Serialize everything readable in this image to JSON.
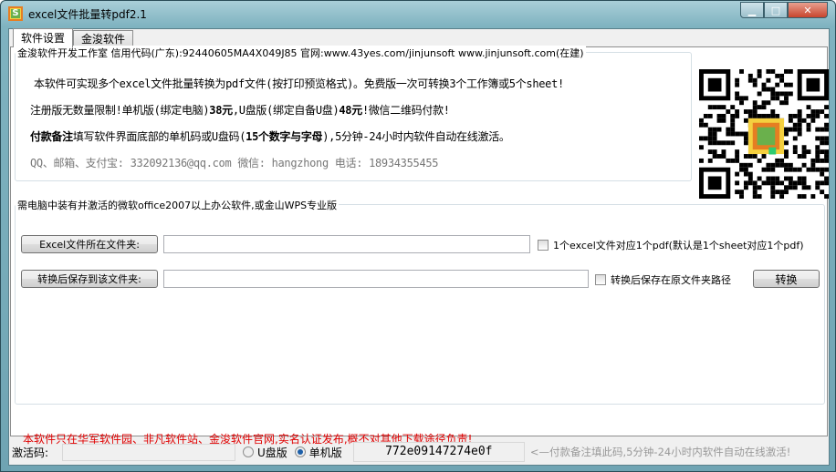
{
  "window": {
    "title": "excel文件批量转pdf2.1",
    "icon": "app-logo-icon",
    "controls": [
      "minimize-icon",
      "maximize-icon",
      "close-icon"
    ]
  },
  "tabs": [
    {
      "label": "软件设置",
      "active": true
    },
    {
      "label": "金浚软件",
      "active": false
    }
  ],
  "info": {
    "legend": "金浚软件开发工作室 信用代码(广东):92440605MA4X049J85 官网:www.43yes.com/jinjunsoft  www.jinjunsoft.com(在建)",
    "line1": "本软件可实现多个excel文件批量转换为pdf文件(按打印预览格式)。免费版一次可转换3个工作簿或5个sheet!",
    "line2_a": "注册版无数量限制!单机版(绑定电脑)",
    "line2_b": "38元",
    "line2_c": ",U盘版(绑定自备U盘)",
    "line2_d": "48元",
    "line2_e": "!微信二维码付款!",
    "line3_a": "付款备注",
    "line3_b": "填写软件界面底部的单机码或U盘码(",
    "line3_c": "15个数字与字母",
    "line3_d": ")",
    "line3_e": ",5分钟-24小时内软件自动在线激活。",
    "contact": "QQ、邮箱、支付宝: 332092136@qq.com   微信: hangzhong   电话: 18934355455"
  },
  "convert": {
    "legend": "需电脑中装有并激活的微软office2007以上办公软件,或金山WPS专业版",
    "excel_folder_button": "Excel文件所在文件夹:",
    "excel_folder_value": "",
    "one_per_file_checkbox": "1个excel文件对应1个pdf(默认是1个sheet对应1个pdf)",
    "one_per_file_checked": false,
    "save_folder_button": "转换后保存到该文件夹:",
    "save_folder_value": "",
    "save_original_checkbox": "转换后保存在原文件夹路径",
    "save_original_checked": false,
    "convert_button": "转换"
  },
  "notice": "本软件只在华军软件园、非凡软件站、金浚软件官网,实名认证发布,概不对其他下载途径负责!",
  "bottom": {
    "activation_label": "激活码:",
    "activation_value": "",
    "usb_label": "U盘版",
    "pc_label": "单机版",
    "selected": "单机版",
    "machine_code": "772e09147274e0f",
    "hint": "<—付款备注填此码,5分钟-24小时内软件自动在线激活!"
  }
}
